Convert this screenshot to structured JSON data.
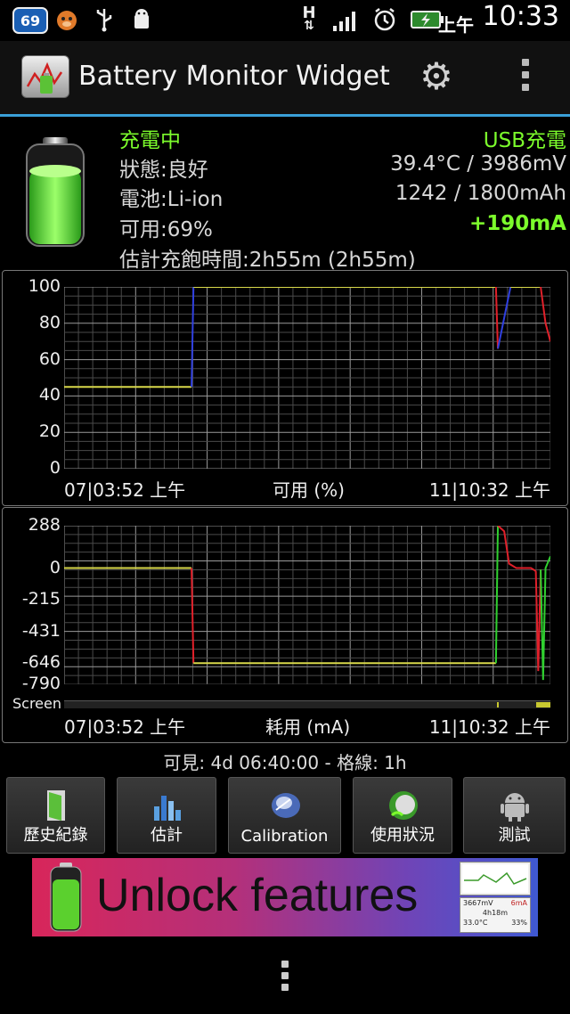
{
  "status_bar": {
    "badge": "69",
    "network": "H",
    "ampm": "上午",
    "time": "10:33"
  },
  "header": {
    "title": "Battery Monitor Widget",
    "settings_icon": "gear-icon",
    "overflow_icon": "overflow-menu-icon"
  },
  "info": {
    "charging": "充電中",
    "source": "USB充電",
    "status": "狀態:良好",
    "temp_voltage": "39.4°C / 3986mV",
    "battery_type": "電池:Li-ion",
    "capacity": "1242 / 1800mAh",
    "available": "可用:69%",
    "current": "+190mA",
    "estimate": "估計充飽時間:2h55m (2h55m)"
  },
  "chart1": {
    "y_ticks": [
      "100",
      "80",
      "60",
      "40",
      "20",
      "0"
    ],
    "x_start": "07|03:52 上午",
    "x_title": "可用 (%)",
    "x_end": "11|10:32 上午"
  },
  "chart2": {
    "y_ticks": [
      "288",
      "0",
      "-215",
      "-431",
      "-646",
      "-790"
    ],
    "screen_label": "Screen",
    "x_start": "07|03:52 上午",
    "x_title": "耗用 (mA)",
    "x_end": "11|10:32 上午"
  },
  "chart_data": [
    {
      "type": "line",
      "title": "",
      "xlabel": "可用 (%)",
      "ylabel": "",
      "ylim": [
        0,
        100
      ],
      "x_range": [
        "07|03:52 上午",
        "11|10:32 上午"
      ],
      "series": [
        {
          "values": [
            45,
            45,
            45,
            100,
            100,
            100,
            100,
            66,
            100,
            100,
            80,
            70
          ]
        }
      ]
    },
    {
      "type": "line",
      "title": "",
      "xlabel": "耗用 (mA)",
      "ylabel": "",
      "ylim": [
        -790,
        288
      ],
      "x_range": [
        "07|03:52 上午",
        "11|10:32 上午"
      ],
      "series": [
        {
          "values": [
            0,
            0,
            0,
            -646,
            -646,
            -646,
            -646,
            288,
            200,
            0,
            -10,
            -700,
            0
          ]
        }
      ]
    }
  ],
  "footer_info": "可見: 4d 06:40:00 - 格線: 1h",
  "buttons": [
    {
      "label": "歷史紀錄",
      "icon": "door-icon"
    },
    {
      "label": "估計",
      "icon": "chart-icon"
    },
    {
      "label": "Calibration",
      "icon": "calibration-icon"
    },
    {
      "label": "使用狀況",
      "icon": "usage-icon"
    },
    {
      "label": "測試",
      "icon": "android-icon"
    }
  ],
  "banner": {
    "text": "Unlock features",
    "mini_voltage": "3667mV",
    "mini_current": "6mA",
    "mini_time": "4h18m",
    "mini_temp": "33.0°C",
    "mini_percent": "33%"
  },
  "colors": {
    "accent": "#3aa0d8",
    "charge_green": "#7CFC2C",
    "line_yellow": "#d8d84a",
    "line_red": "#e0202a",
    "line_blue": "#3040e0",
    "line_green": "#30d030"
  }
}
